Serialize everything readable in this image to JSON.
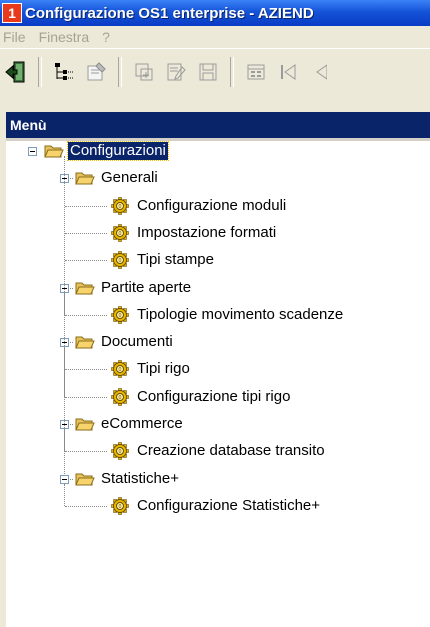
{
  "window": {
    "title": "Configurazione OS1 enterprise - AZIEND",
    "icon_glyph": "1"
  },
  "menubar": {
    "items": [
      "File",
      "Finestra",
      "?"
    ]
  },
  "toolbar": {
    "icons": [
      "exit-icon",
      "tree-icon",
      "properties-icon",
      "new-record-icon",
      "edit-record-icon",
      "save-icon",
      "form-icon",
      "first-record-icon",
      "previous-record-icon"
    ]
  },
  "panel": {
    "title": "Menù"
  },
  "tree": {
    "root": "Configurazioni",
    "groups": [
      {
        "label": "Generali",
        "items": [
          "Configurazione moduli",
          "Impostazione formati",
          "Tipi stampe"
        ]
      },
      {
        "label": "Partite aperte",
        "items": [
          "Tipologie movimento scadenze"
        ]
      },
      {
        "label": "Documenti",
        "items": [
          "Tipi rigo",
          "Configurazione tipi rigo"
        ]
      },
      {
        "label": "eCommerce",
        "items": [
          "Creazione database transito"
        ]
      },
      {
        "label": "Statistiche+",
        "items": [
          "Configurazione Statistiche+"
        ]
      }
    ]
  },
  "colors": {
    "selection": "#0a246a",
    "titlebar": "#1453d8",
    "panel_header": "#0a246a",
    "folder": "#f6d36b",
    "gear": "#e7b800"
  }
}
